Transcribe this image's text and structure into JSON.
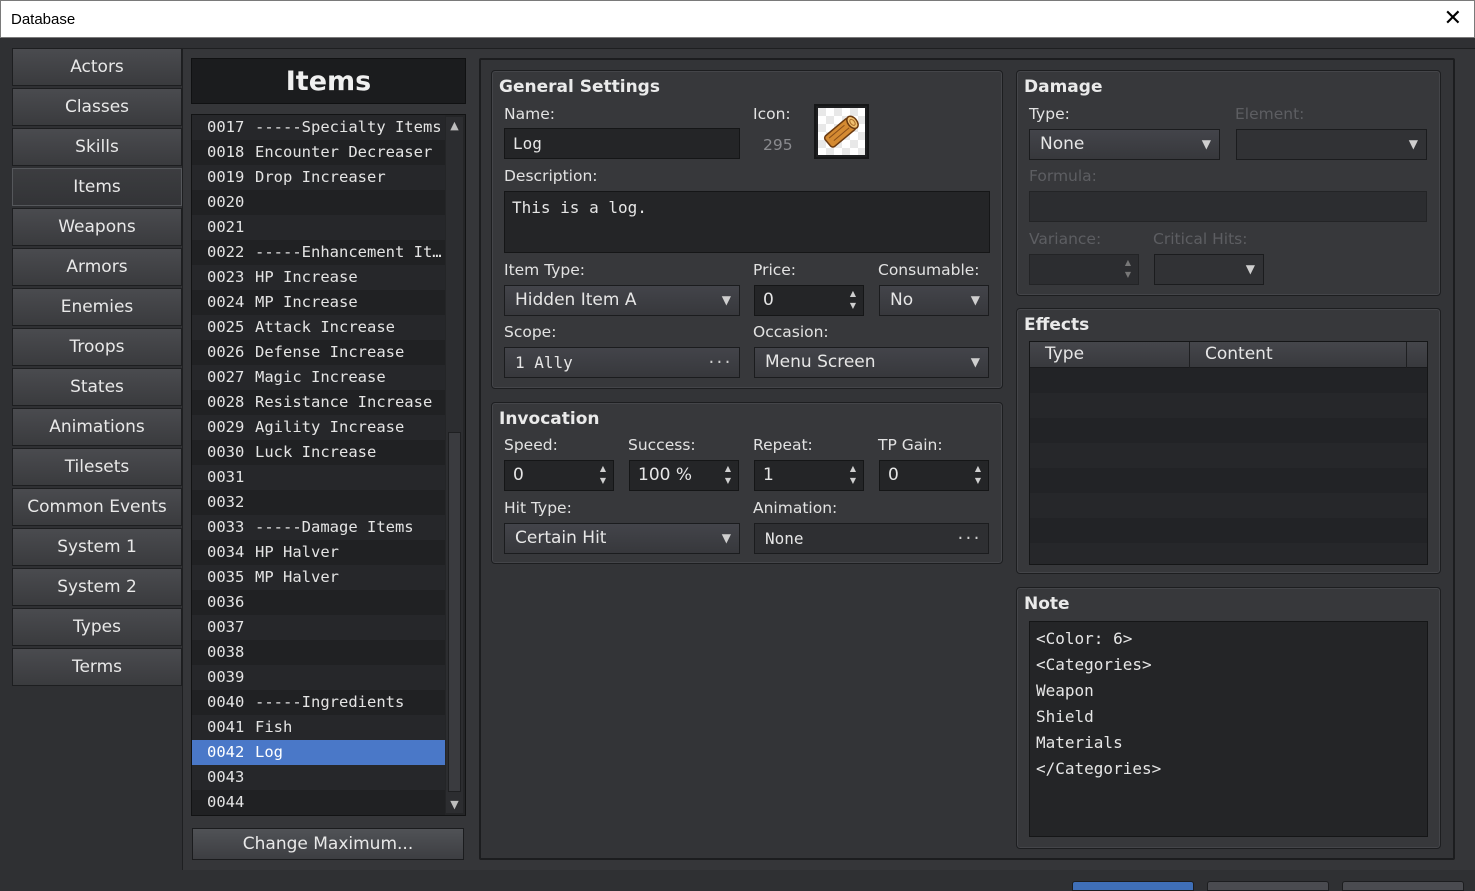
{
  "window": {
    "title": "Database",
    "close_glyph": "✕"
  },
  "categories": [
    {
      "label": "Actors"
    },
    {
      "label": "Classes"
    },
    {
      "label": "Skills"
    },
    {
      "label": "Items",
      "active": true
    },
    {
      "label": "Weapons"
    },
    {
      "label": "Armors"
    },
    {
      "label": "Enemies"
    },
    {
      "label": "Troops"
    },
    {
      "label": "States"
    },
    {
      "label": "Animations"
    },
    {
      "label": "Tilesets"
    },
    {
      "label": "Common Events"
    },
    {
      "label": "System 1"
    },
    {
      "label": "System 2"
    },
    {
      "label": "Types"
    },
    {
      "label": "Terms"
    }
  ],
  "item_list": {
    "header": "Items",
    "selected_index": 25,
    "rows": [
      {
        "id": "0017",
        "name": "-----Specialty Items"
      },
      {
        "id": "0018",
        "name": "Encounter Decreaser"
      },
      {
        "id": "0019",
        "name": "Drop Increaser"
      },
      {
        "id": "0020",
        "name": ""
      },
      {
        "id": "0021",
        "name": ""
      },
      {
        "id": "0022",
        "name": "-----Enhancement It…"
      },
      {
        "id": "0023",
        "name": "HP Increase"
      },
      {
        "id": "0024",
        "name": "MP Increase"
      },
      {
        "id": "0025",
        "name": "Attack Increase"
      },
      {
        "id": "0026",
        "name": "Defense Increase"
      },
      {
        "id": "0027",
        "name": "Magic Increase"
      },
      {
        "id": "0028",
        "name": "Resistance Increase"
      },
      {
        "id": "0029",
        "name": "Agility Increase"
      },
      {
        "id": "0030",
        "name": "Luck Increase"
      },
      {
        "id": "0031",
        "name": ""
      },
      {
        "id": "0032",
        "name": ""
      },
      {
        "id": "0033",
        "name": "-----Damage Items"
      },
      {
        "id": "0034",
        "name": "HP Halver"
      },
      {
        "id": "0035",
        "name": "MP Halver"
      },
      {
        "id": "0036",
        "name": ""
      },
      {
        "id": "0037",
        "name": ""
      },
      {
        "id": "0038",
        "name": ""
      },
      {
        "id": "0039",
        "name": ""
      },
      {
        "id": "0040",
        "name": "-----Ingredients"
      },
      {
        "id": "0041",
        "name": "Fish"
      },
      {
        "id": "0042",
        "name": "Log"
      },
      {
        "id": "0043",
        "name": ""
      },
      {
        "id": "0044",
        "name": ""
      }
    ],
    "change_max_label": "Change Maximum..."
  },
  "general": {
    "title": "General Settings",
    "name_label": "Name:",
    "name_value": "Log",
    "icon_label": "Icon:",
    "icon_index": "295",
    "icon_name": "log-icon",
    "desc_label": "Description:",
    "desc_value": "This is a log.",
    "item_type_label": "Item Type:",
    "item_type_value": "Hidden Item A",
    "price_label": "Price:",
    "price_value": "0",
    "consumable_label": "Consumable:",
    "consumable_value": "No",
    "scope_label": "Scope:",
    "scope_value": "1 Ally",
    "occasion_label": "Occasion:",
    "occasion_value": "Menu Screen"
  },
  "invocation": {
    "title": "Invocation",
    "speed_label": "Speed:",
    "speed_value": "0",
    "success_label": "Success:",
    "success_value": "100 %",
    "repeat_label": "Repeat:",
    "repeat_value": "1",
    "tp_label": "TP Gain:",
    "tp_value": "0",
    "hit_type_label": "Hit Type:",
    "hit_type_value": "Certain Hit",
    "animation_label": "Animation:",
    "animation_value": "None"
  },
  "damage": {
    "title": "Damage",
    "type_label": "Type:",
    "type_value": "None",
    "element_label": "Element:",
    "element_value": "",
    "formula_label": "Formula:",
    "formula_value": "",
    "variance_label": "Variance:",
    "variance_value": "",
    "critical_label": "Critical Hits:",
    "critical_value": ""
  },
  "effects": {
    "title": "Effects",
    "col_type": "Type",
    "col_content": "Content"
  },
  "note": {
    "title": "Note",
    "lines": [
      "<Color: 6>",
      "<Categories>",
      "Weapon",
      "Shield",
      "Materials",
      "</Categories>"
    ]
  },
  "colors": {
    "selection": "#4a78c8",
    "panel": "#37383b",
    "field": "#242527"
  }
}
